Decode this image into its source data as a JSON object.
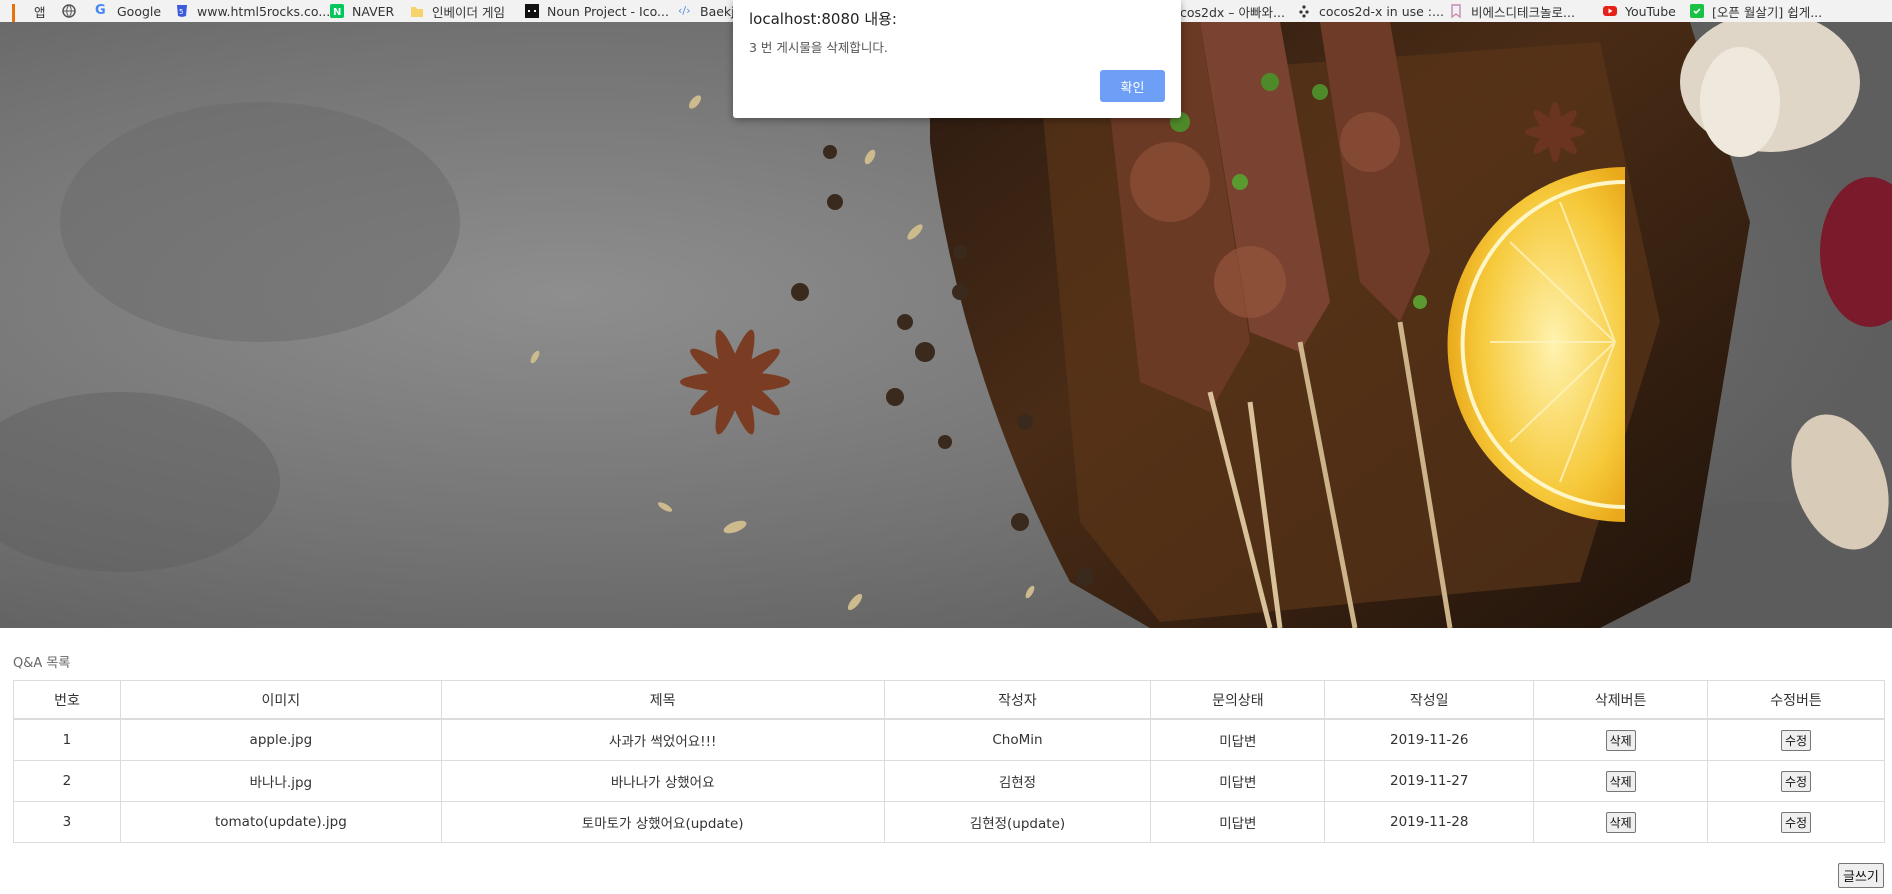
{
  "bookmarks": [
    {
      "label": "앱",
      "icon": "apps-icon"
    },
    {
      "label": "",
      "icon": "globe-icon"
    },
    {
      "label": "Google",
      "icon": "google-icon"
    },
    {
      "label": "www.html5rocks.co...",
      "icon": "html5-icon"
    },
    {
      "label": "NAVER",
      "icon": "naver-icon"
    },
    {
      "label": "인베이더 게임",
      "icon": "folder-icon"
    },
    {
      "label": "Noun Project - Ico...",
      "icon": "noun-project-icon"
    },
    {
      "label": "Baekj",
      "icon": "code-icon"
    },
    {
      "label": "cos2dx – 아빠와...",
      "icon": ""
    },
    {
      "label": "cocos2d-x in use :...",
      "icon": "cocos-icon"
    },
    {
      "label": "비에스디테크놀로...",
      "icon": "bookmark-icon"
    },
    {
      "label": "YouTube",
      "icon": "youtube-icon"
    },
    {
      "label": "[오픈 월살기] 쉽게...",
      "icon": "green-bookmark-icon"
    }
  ],
  "dialog": {
    "title": "localhost:8080 내용:",
    "message": "3 번 게시물을 삭제합니다.",
    "ok_label": "확인"
  },
  "list": {
    "title": "Q&A 목록",
    "columns": [
      "번호",
      "이미지",
      "제목",
      "작성자",
      "문의상태",
      "작성일",
      "삭제버튼",
      "수정버튼"
    ],
    "rows": [
      {
        "no": "1",
        "image": "apple.jpg",
        "subject": "사과가 썩었어요!!!",
        "writer": "ChoMin",
        "status": "미답변",
        "date": "2019-11-26",
        "delete_label": "삭제",
        "edit_label": "수정"
      },
      {
        "no": "2",
        "image": "바나나.jpg",
        "subject": "바나나가 상했어요",
        "writer": "김현정",
        "status": "미답변",
        "date": "2019-11-27",
        "delete_label": "삭제",
        "edit_label": "수정"
      },
      {
        "no": "3",
        "image": "tomato(update).jpg",
        "subject": "토마토가 상했어요(update)",
        "writer": "김현정(update)",
        "status": "미답변",
        "date": "2019-11-28",
        "delete_label": "삭제",
        "edit_label": "수정"
      }
    ],
    "write_label": "글쓰기"
  }
}
